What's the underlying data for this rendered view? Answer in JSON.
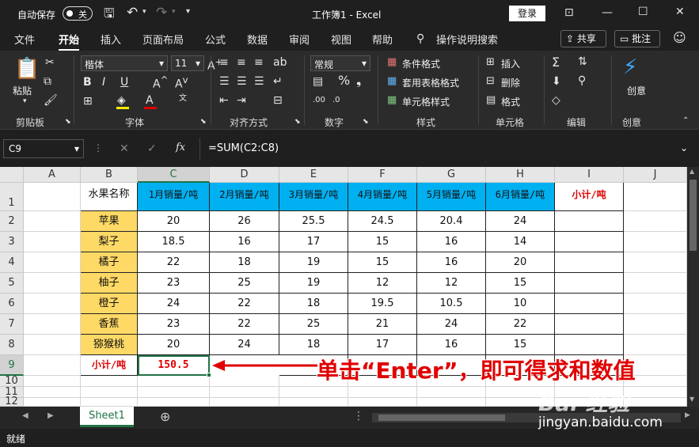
{
  "titlebar": {
    "autosave_label": "自动保存",
    "autosave_state": "关",
    "title": "工作簿1 - Excel",
    "login_label": "登录"
  },
  "tabs": [
    "文件",
    "开始",
    "插入",
    "页面布局",
    "公式",
    "数据",
    "审阅",
    "视图",
    "帮助"
  ],
  "active_tab": "开始",
  "search_label": "操作说明搜索",
  "share_label": "共享",
  "comment_label": "批注",
  "ribbon": {
    "clipboard": {
      "paste_label": "粘贴",
      "group_label": "剪贴板"
    },
    "font": {
      "font_name": "楷体",
      "font_size": "11",
      "bold": "B",
      "italic": "I",
      "underline": "U",
      "group_label": "字体"
    },
    "alignment": {
      "group_label": "对齐方式"
    },
    "number": {
      "format": "常规",
      "group_label": "数字"
    },
    "styles": {
      "conditional": "条件格式",
      "table": "套用表格格式",
      "cell_styles": "单元格样式",
      "group_label": "样式"
    },
    "cells": {
      "insert": "插入",
      "delete": "删除",
      "format": "格式",
      "group_label": "单元格"
    },
    "editing": {
      "group_label": "编辑"
    },
    "creativity": {
      "create_label": "创意",
      "group_label": "创意"
    }
  },
  "formula_bar": {
    "name_box": "C9",
    "fx": "fx",
    "formula": "=SUM(C2:C8)"
  },
  "columns": [
    "A",
    "B",
    "C",
    "D",
    "E",
    "F",
    "G",
    "H",
    "I",
    "J"
  ],
  "rows": [
    "1",
    "2",
    "3",
    "4",
    "5",
    "6",
    "7",
    "8",
    "9",
    "10",
    "11",
    "12"
  ],
  "table": {
    "header": [
      "水果名称",
      "1月销量/吨",
      "2月销量/吨",
      "3月销量/吨",
      "4月销量/吨",
      "5月销量/吨",
      "6月销量/吨",
      "小计/吨"
    ],
    "rows": [
      [
        "苹果",
        "20",
        "26",
        "25.5",
        "24.5",
        "20.4",
        "24"
      ],
      [
        "梨子",
        "18.5",
        "16",
        "17",
        "15",
        "16",
        "14"
      ],
      [
        "橘子",
        "22",
        "18",
        "19",
        "15",
        "16",
        "20"
      ],
      [
        "柚子",
        "23",
        "25",
        "19",
        "12",
        "12",
        "15"
      ],
      [
        "橙子",
        "24",
        "22",
        "18",
        "19.5",
        "10.5",
        "10"
      ],
      [
        "香蕉",
        "23",
        "22",
        "25",
        "21",
        "24",
        "22"
      ],
      [
        "猕猴桃",
        "20",
        "24",
        "18",
        "17",
        "16",
        "15"
      ]
    ],
    "subtotal_label": "小计/吨",
    "subtotal_value": "150.5"
  },
  "annotation": "单击“Enter”，即可得求和数值",
  "sheet_tab": "Sheet1",
  "status": "就绪",
  "watermark_text": "jingyan.baidu.com",
  "colors": {
    "accent_green": "#217346",
    "header_blue": "#00b0f0",
    "fruit_yellow": "#ffd966",
    "annotation_red": "#e00000"
  }
}
